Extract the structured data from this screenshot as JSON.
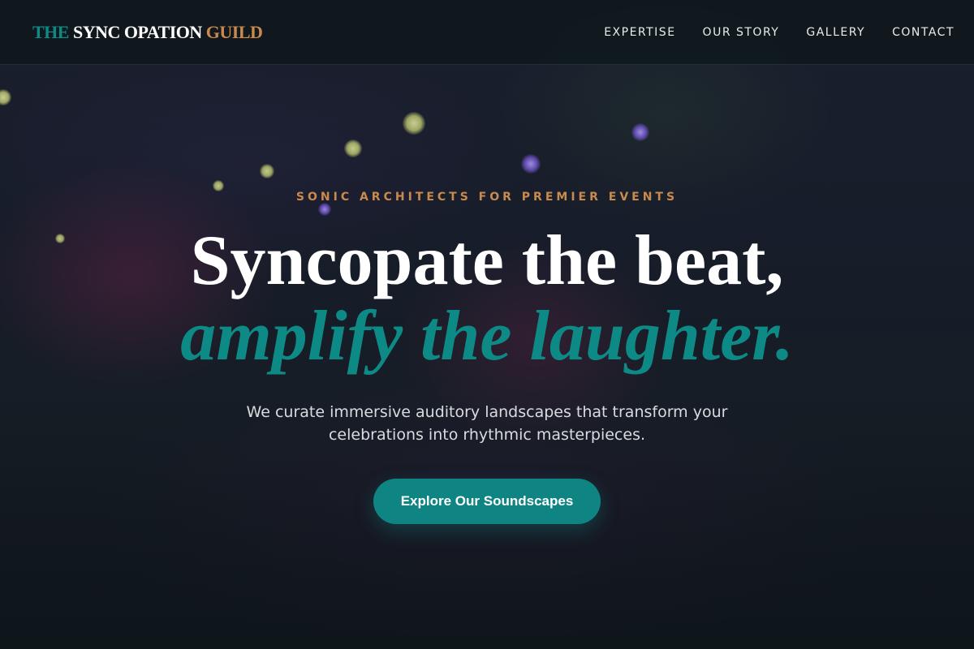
{
  "header": {
    "logo": {
      "part1": "THE",
      "part2": "SYNC OPATION",
      "part3": "GUILD"
    },
    "nav": [
      "EXPERTISE",
      "OUR STORY",
      "GALLERY",
      "CONTACT"
    ]
  },
  "hero": {
    "eyebrow": "SONIC ARCHITECTS FOR PREMIER EVENTS",
    "headline_line1": "Syncopate the beat,",
    "headline_line2": "amplify the laughter.",
    "subtext": "We curate immersive auditory landscapes that transform your celebrations into rhythmic masterpieces.",
    "cta_label": "Explore Our Soundscapes"
  },
  "colors": {
    "teal_accent": "#0e8a86",
    "copper_accent": "#c98a4e",
    "header_bg": "#0f181c",
    "text_white": "#ffffff"
  }
}
